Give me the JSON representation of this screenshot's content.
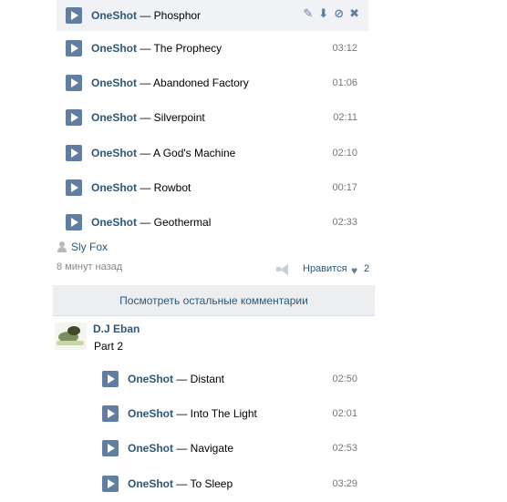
{
  "playlist1": {
    "tracks": [
      {
        "artist": "OneShot",
        "title": "Phosphor",
        "duration": ""
      },
      {
        "artist": "OneShot",
        "title": "The Prophecy",
        "duration": "03:12"
      },
      {
        "artist": "OneShot",
        "title": "Abandoned Factory",
        "duration": "01:06"
      },
      {
        "artist": "OneShot",
        "title": "Silverpoint",
        "duration": "02:11"
      },
      {
        "artist": "OneShot",
        "title": "A God's Machine",
        "duration": "02:10"
      },
      {
        "artist": "OneShot",
        "title": "Rowbot",
        "duration": "00:17"
      },
      {
        "artist": "OneShot",
        "title": "Geothermal",
        "duration": "02:33"
      }
    ],
    "hover_actions": [
      "pencil-icon",
      "download-icon",
      "exclude-icon",
      "close-icon"
    ]
  },
  "separator": " — ",
  "post": {
    "author": "Sly Fox",
    "time": "8 минут назад",
    "like_label": "Нравится",
    "like_count": "2"
  },
  "comments": {
    "show_more": "Посмотреть остальные комментарии",
    "item": {
      "author": "D.J Eban",
      "text": "Part 2",
      "tracks": [
        {
          "artist": "OneShot",
          "title": "Distant",
          "duration": "02:50"
        },
        {
          "artist": "OneShot",
          "title": "Into The Light",
          "duration": "02:01"
        },
        {
          "artist": "OneShot",
          "title": "Navigate",
          "duration": "02:53"
        },
        {
          "artist": "OneShot",
          "title": "To Sleep",
          "duration": "03:29"
        }
      ]
    }
  }
}
